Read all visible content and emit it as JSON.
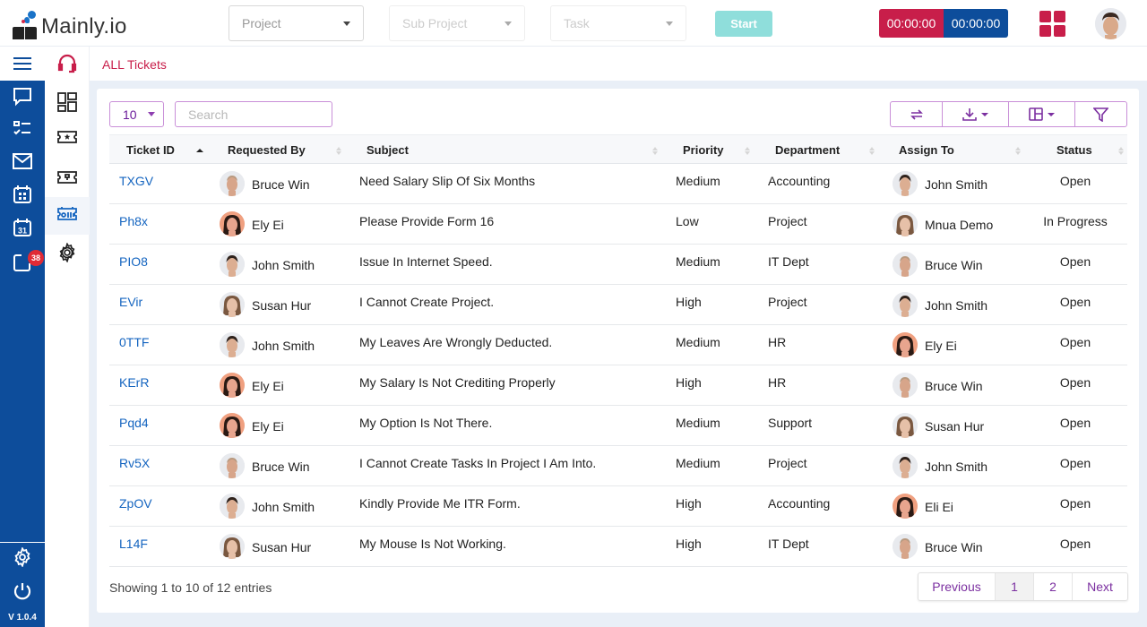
{
  "app": {
    "logo_text": "Mainly.io",
    "version": "V 1.0.4"
  },
  "header": {
    "project_placeholder": "Project",
    "subproject_placeholder": "Sub Project",
    "task_placeholder": "Task",
    "start_label": "Start",
    "timer_left": "00:00:00",
    "timer_right": "00:00:00",
    "colors": {
      "accent_red": "#c81e4a",
      "accent_blue": "#0d4d9b",
      "start_teal": "#8fdedb"
    }
  },
  "sidebar": {
    "items": [
      {
        "icon": "menu-icon"
      },
      {
        "icon": "chat-icon"
      },
      {
        "icon": "checklist-icon"
      },
      {
        "icon": "mail-icon"
      },
      {
        "icon": "calendar-grid-icon"
      },
      {
        "icon": "calendar-31-icon"
      },
      {
        "icon": "notification-icon",
        "badge": "38"
      },
      {
        "icon": "settings-icon"
      },
      {
        "icon": "power-icon"
      }
    ],
    "calendar_day": "31"
  },
  "sidebar2": {
    "items": [
      {
        "icon": "headset-icon"
      },
      {
        "icon": "dashboard-icon"
      },
      {
        "icon": "ticket-star-icon"
      },
      {
        "icon": "ticket-icon"
      },
      {
        "icon": "ticket-list-icon",
        "active": true
      },
      {
        "icon": "settings-icon"
      }
    ]
  },
  "breadcrumb": "ALL Tickets",
  "table_controls": {
    "page_length": "10",
    "search_placeholder": "Search",
    "tools": [
      "refresh-icon",
      "download-icon",
      "columns-icon",
      "filter-icon"
    ]
  },
  "table": {
    "columns": [
      "Ticket ID",
      "Requested By",
      "Subject",
      "Priority",
      "Department",
      "Assign To",
      "Status"
    ],
    "rows": [
      {
        "id": "TXGV",
        "requested_by": "Bruce Win",
        "subject": "Need Salary Slip Of Six Months",
        "priority": "Medium",
        "department": "Accounting",
        "assign_to": "John Smith",
        "status": "Open"
      },
      {
        "id": "Ph8x",
        "requested_by": "Ely Ei",
        "subject": "Please Provide Form 16",
        "priority": "Low",
        "department": "Project",
        "assign_to": "Mnua Demo",
        "status": "In Progress"
      },
      {
        "id": "PIO8",
        "requested_by": "John Smith",
        "subject": "Issue In Internet Speed.",
        "priority": "Medium",
        "department": "IT Dept",
        "assign_to": "Bruce Win",
        "status": "Open"
      },
      {
        "id": "EVir",
        "requested_by": "Susan Hur",
        "subject": "I Cannot Create Project.",
        "priority": "High",
        "department": "Project",
        "assign_to": "John Smith",
        "status": "Open"
      },
      {
        "id": "0TTF",
        "requested_by": "John Smith",
        "subject": "My Leaves Are Wrongly Deducted.",
        "priority": "Medium",
        "department": "HR",
        "assign_to": "Ely Ei",
        "status": "Open"
      },
      {
        "id": "KErR",
        "requested_by": "Ely Ei",
        "subject": "My Salary Is Not Crediting Properly",
        "priority": "High",
        "department": "HR",
        "assign_to": "Bruce Win",
        "status": "Open"
      },
      {
        "id": "Pqd4",
        "requested_by": "Ely Ei",
        "subject": "My Option Is Not There.",
        "priority": "Medium",
        "department": "Support",
        "assign_to": "Susan Hur",
        "status": "Open"
      },
      {
        "id": "Rv5X",
        "requested_by": "Bruce Win",
        "subject": "I Cannot Create Tasks In Project I Am Into.",
        "priority": "Medium",
        "department": "Project",
        "assign_to": "John Smith",
        "status": "Open"
      },
      {
        "id": "ZpOV",
        "requested_by": "John Smith",
        "subject": "Kindly Provide Me ITR Form.",
        "priority": "High",
        "department": "Accounting",
        "assign_to": "Eli Ei",
        "status": "Open"
      },
      {
        "id": "L14F",
        "requested_by": "Susan Hur",
        "subject": "My Mouse Is Not Working.",
        "priority": "High",
        "department": "IT Dept",
        "assign_to": "Bruce Win",
        "status": "Open"
      }
    ]
  },
  "footer": {
    "info": "Showing 1 to 10 of 12 entries",
    "pagination": {
      "previous": "Previous",
      "pages": [
        "1",
        "2"
      ],
      "current": "1",
      "next": "Next"
    }
  }
}
